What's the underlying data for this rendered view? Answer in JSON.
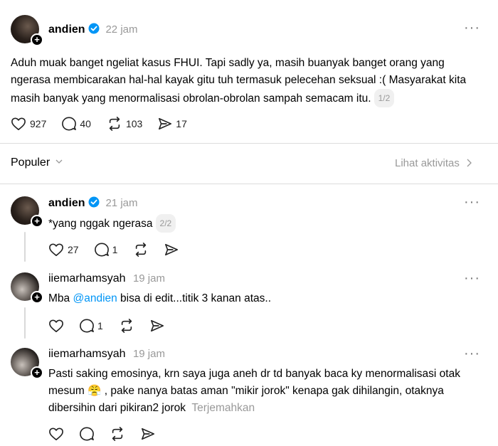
{
  "main_post": {
    "username": "andien",
    "time": "22 jam",
    "text": "Aduh muak banget ngeliat kasus FHUI. Tapi sadly ya, masih buanyak banget orang yang ngerasa membicarakan hal-hal kayak gitu tuh termasuk pelecehan seksual :( Masyarakat kita masih banyak yang menormalisasi obrolan-obrolan sampah semacam itu.",
    "pager": "1/2",
    "likes": "927",
    "replies": "40",
    "reposts": "103",
    "shares": "17"
  },
  "sort_bar": {
    "label": "Populer",
    "activity_link": "Lihat aktivitas"
  },
  "replies": [
    {
      "username": "andien",
      "time": "21 jam",
      "text": "*yang nggak ngerasa",
      "pager": "2/2",
      "likes": "27",
      "replies": "1"
    },
    {
      "username": "iiemarhamsyah",
      "time": "19 jam",
      "text_before": "Mba ",
      "mention": "@andien",
      "text_after": " bisa di edit...titik 3 kanan atas..",
      "replies": "1"
    },
    {
      "username": "iiemarhamsyah",
      "time": "19 jam",
      "text": "Pasti saking emosinya, krn saya juga aneh dr td banyak baca ky menormalisasi otak mesum 😤 , pake nanya batas aman \"mikir jorok\" kenapa gak dihilangin, otaknya dibersihin dari pikiran2 jorok",
      "translate": "Terjemahkan"
    }
  ],
  "icons": {
    "verified_color": "#0095f6",
    "more": "more-icon",
    "like": "heart-icon",
    "reply": "comment-icon",
    "repost": "repost-icon",
    "share": "share-icon"
  }
}
